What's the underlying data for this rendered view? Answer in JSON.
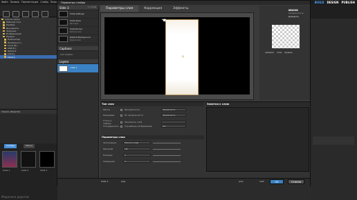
{
  "app": {
    "menu": [
      "Файл",
      "Правка",
      "Презентация",
      "Слайд",
      "Показ",
      "Вид",
      "Справка"
    ],
    "mode_tabs": [
      "BUILD",
      "DESIGN",
      "PUBLISH"
    ],
    "tree": [
      {
        "label": "Список папок",
        "sel": false
      },
      {
        "label": "Рабочий стол",
        "sel": false
      },
      {
        "label": "Desktop",
        "sel": false
      },
      {
        "label": "Документы",
        "sel": false
      },
      {
        "label": "Загрузки",
        "sel": false
      },
      {
        "label": "Изображения",
        "sel": false
      },
      {
        "label": "Музыка",
        "sel": false
      },
      {
        "label": "Компьютер",
        "sel": false
      },
      {
        "label": "Windows (C:)",
        "sel": false
      },
      {
        "label": "Local (D:)",
        "sel": false
      },
      {
        "label": "USB (E:)",
        "sel": false
      },
      {
        "label": "Network",
        "sel": false
      },
      {
        "label": "Library",
        "sel": false
      },
      {
        "label": "Library",
        "sel": true
      }
    ],
    "left_lower_title": "Список объектов",
    "slides_tabs": [
      "Слайды",
      "Маски"
    ],
    "slide_labels": [
      "Slide 1",
      "Slide 2",
      "Slide 3"
    ],
    "bottom_text": "Медленно дорогие"
  },
  "dialog": {
    "title": "Параметры слайда",
    "slide_header": "Slide 3",
    "slide_count": "1 / 1 slide",
    "layouts": [
      {
        "name": "Slide Settings",
        "sub": ""
      },
      {
        "name": "Slide Style",
        "sub": "Main Style"
      },
      {
        "name": "Slide Border",
        "sub": "Border & Color"
      },
      {
        "name": "Default Background",
        "sub": "Styles & Color"
      }
    ],
    "captions_label": "Captions",
    "add_caption": "Add Caption",
    "layers_label": "Layers",
    "layer_name": "слой 1",
    "tabs": [
      "Параметры слоя",
      "Коррекция",
      "Эффекты"
    ],
    "props_title": "маска",
    "props_sub": "прозрачность",
    "props_add_btn": "Добавить",
    "props_btns": [
      "заливка",
      "поле",
      "правка"
    ],
    "section_layer": "Тип слоя",
    "rows": [
      {
        "label": "Маска",
        "opt": "Прозрачность",
        "val": "Прозрачность"
      },
      {
        "label": "Карандаш",
        "opt": "По прозрачности",
        "val": "Прозрачность"
      },
      {
        "label": "Стиль и наборы",
        "opt": "Заполнить слой",
        "val": ""
      },
      {
        "label": "Сотрудничать",
        "opt": "Случайные изображения",
        "val": "Нет"
      }
    ],
    "section_notes": "Заметки к слою",
    "section_params": "Параметры слоя",
    "param_rows": [
      {
        "label": "Заполнение",
        "val": "Вписать в кадр"
      },
      {
        "label": "Масштаб",
        "val": "100"
      },
      {
        "label": "Позиция",
        "val": "0"
      },
      {
        "label": "Смещение",
        "val": "0"
      }
    ],
    "bottom_left": "Slide 3",
    "bottom_play": "play",
    "bottom_items": [
      "prev",
      "next"
    ],
    "ok": "OK",
    "cancel": "Отмена"
  },
  "colors": {
    "accent": "#4a90d9",
    "selected": "#3b6cb0"
  }
}
